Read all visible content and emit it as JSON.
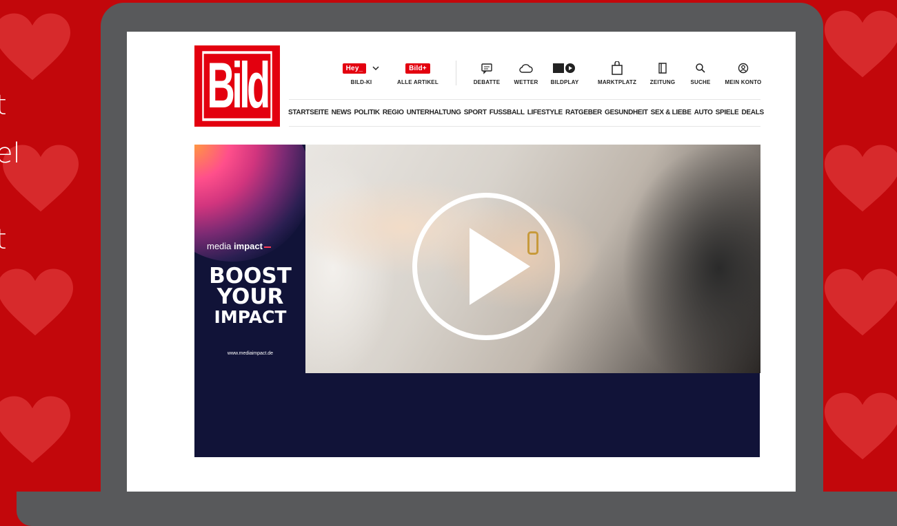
{
  "background": {
    "color": "#c2070b",
    "side_text": [
      "t",
      "el",
      "t"
    ]
  },
  "header": {
    "logo": "Bild",
    "toolbar": [
      {
        "name": "bild-ki",
        "badge": "Hey_",
        "label": "BILD-KI",
        "icon": "chevron-down-icon"
      },
      {
        "name": "alle-artikel",
        "badge": "Bild+",
        "label": "ALLE ARTIKEL",
        "icon": "bild-plus-icon"
      },
      {
        "name": "debatte",
        "label": "DEBATTE",
        "icon": "chat-bubble-icon"
      },
      {
        "name": "wetter",
        "label": "WETTER",
        "icon": "cloud-icon"
      },
      {
        "name": "bildplay",
        "label": "BILDPLAY",
        "icon": "bildplay-icon"
      },
      {
        "name": "marktplatz",
        "label": "MARKTPLATZ",
        "icon": "shopping-bag-icon"
      },
      {
        "name": "zeitung",
        "label": "ZEITUNG",
        "icon": "newspaper-icon"
      },
      {
        "name": "suche",
        "label": "SUCHE",
        "icon": "search-icon"
      },
      {
        "name": "mein-konto",
        "label": "MEIN KONTO",
        "icon": "user-icon"
      }
    ],
    "nav": [
      "STARTSEITE",
      "NEWS",
      "POLITIK",
      "REGIO",
      "UNTERHALTUNG",
      "SPORT",
      "FUSSBALL",
      "LIFESTYLE",
      "RATGEBER",
      "GESUNDHEIT",
      "SEX & LIEBE",
      "AUTO",
      "SPIELE",
      "DEALS"
    ]
  },
  "ad": {
    "brand_light": "media",
    "brand_bold": "impact",
    "headline_1": "BOOST",
    "headline_2": "YOUR",
    "headline_3": "IMPACT",
    "url": "www.mediaimpact.de"
  },
  "colors": {
    "bild_red": "#e3000f",
    "ad_navy": "#111338",
    "laptop_gray": "#58595b"
  }
}
